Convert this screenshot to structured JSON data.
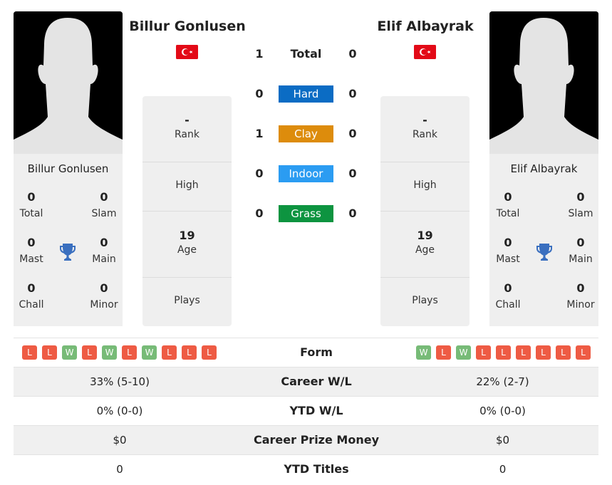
{
  "colors": {
    "hard": "#0b6cc4",
    "clay": "#dd8c0c",
    "indoor": "#2b9cf2",
    "grass": "#0d9440",
    "win": "#77bb77",
    "loss": "#ee5b44",
    "trophy": "#3a6fbf"
  },
  "player_left": {
    "name": "Billur Gonlusen",
    "flag": "turkey-flag",
    "titles": {
      "total": {
        "value": "0",
        "label": "Total"
      },
      "slam": {
        "value": "0",
        "label": "Slam"
      },
      "mast": {
        "value": "0",
        "label": "Mast"
      },
      "main": {
        "value": "0",
        "label": "Main"
      },
      "chall": {
        "value": "0",
        "label": "Chall"
      },
      "minor": {
        "value": "0",
        "label": "Minor"
      }
    },
    "rank": {
      "value": "-",
      "label": "Rank"
    },
    "high": {
      "value": "",
      "label": "High"
    },
    "age": {
      "value": "19",
      "label": "Age"
    },
    "plays": {
      "value": "",
      "label": "Plays"
    },
    "form": [
      "L",
      "L",
      "W",
      "L",
      "W",
      "L",
      "W",
      "L",
      "L",
      "L"
    ]
  },
  "player_right": {
    "name": "Elif Albayrak",
    "flag": "turkey-flag",
    "titles": {
      "total": {
        "value": "0",
        "label": "Total"
      },
      "slam": {
        "value": "0",
        "label": "Slam"
      },
      "mast": {
        "value": "0",
        "label": "Mast"
      },
      "main": {
        "value": "0",
        "label": "Main"
      },
      "chall": {
        "value": "0",
        "label": "Chall"
      },
      "minor": {
        "value": "0",
        "label": "Minor"
      }
    },
    "rank": {
      "value": "-",
      "label": "Rank"
    },
    "high": {
      "value": "",
      "label": "High"
    },
    "age": {
      "value": "19",
      "label": "Age"
    },
    "plays": {
      "value": "",
      "label": "Plays"
    },
    "form": [
      "W",
      "L",
      "W",
      "L",
      "L",
      "L",
      "L",
      "L",
      "L"
    ]
  },
  "h2h": {
    "total": {
      "label": "Total",
      "left": "1",
      "right": "0"
    },
    "surfaces": [
      {
        "key": "hard",
        "label": "Hard",
        "left": "0",
        "right": "0"
      },
      {
        "key": "clay",
        "label": "Clay",
        "left": "1",
        "right": "0"
      },
      {
        "key": "indoor",
        "label": "Indoor",
        "left": "0",
        "right": "0"
      },
      {
        "key": "grass",
        "label": "Grass",
        "left": "0",
        "right": "0"
      }
    ]
  },
  "comparison": {
    "form_label": "Form",
    "rows": [
      {
        "label": "Career W/L",
        "left": "33% (5-10)",
        "right": "22% (2-7)"
      },
      {
        "label": "YTD W/L",
        "left": "0% (0-0)",
        "right": "0% (0-0)"
      },
      {
        "label": "Career Prize Money",
        "left": "$0",
        "right": "$0"
      },
      {
        "label": "YTD Titles",
        "left": "0",
        "right": "0"
      }
    ]
  }
}
